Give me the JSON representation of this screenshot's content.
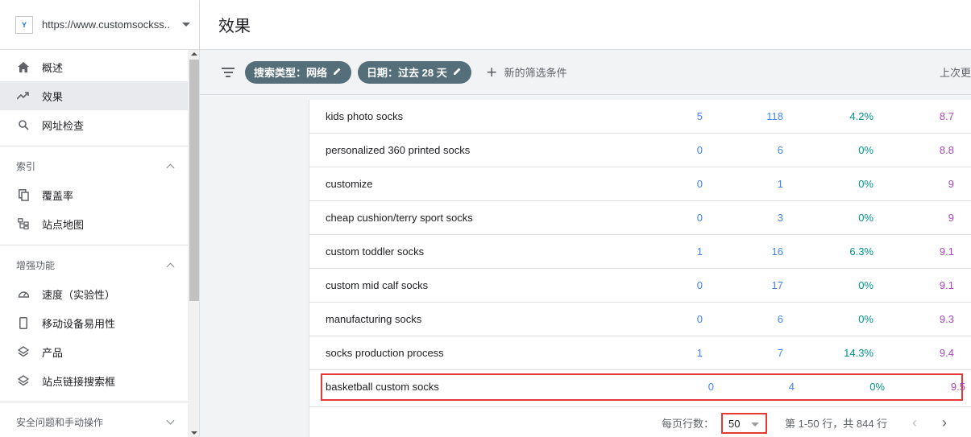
{
  "property": {
    "url": "https://www.customsockss....",
    "logo_text": "Y"
  },
  "header": {
    "title": "效果"
  },
  "sidebar": {
    "top_items": [
      {
        "label": "概述",
        "icon": "home-icon"
      },
      {
        "label": "效果",
        "icon": "trending-up-icon"
      },
      {
        "label": "网址检查",
        "icon": "search-icon"
      }
    ],
    "sections": [
      {
        "title": "索引",
        "items": [
          {
            "label": "覆盖率",
            "icon": "copy-icon"
          },
          {
            "label": "站点地图",
            "icon": "sitemap-icon"
          }
        ]
      },
      {
        "title": "增强功能",
        "items": [
          {
            "label": "速度（实验性）",
            "icon": "speed-icon"
          },
          {
            "label": "移动设备易用性",
            "icon": "phone-icon"
          },
          {
            "label": "产品",
            "icon": "layers-icon"
          },
          {
            "label": "站点链接搜索框",
            "icon": "layers-icon"
          }
        ]
      },
      {
        "title": "安全问题和手动操作",
        "items": []
      }
    ]
  },
  "filters": {
    "chips": [
      {
        "label": "搜索类型：网络"
      },
      {
        "label": "日期：过去 28 天"
      }
    ],
    "new_filter": "新的筛选条件",
    "last_update": "上次更"
  },
  "table": {
    "rows": [
      {
        "query": "kids photo socks",
        "clicks": "5",
        "impressions": "118",
        "ctr": "4.2%",
        "position": "8.7"
      },
      {
        "query": "personalized 360 printed socks",
        "clicks": "0",
        "impressions": "6",
        "ctr": "0%",
        "position": "8.8"
      },
      {
        "query": "customize",
        "clicks": "0",
        "impressions": "1",
        "ctr": "0%",
        "position": "9"
      },
      {
        "query": "cheap cushion/terry sport socks",
        "clicks": "0",
        "impressions": "3",
        "ctr": "0%",
        "position": "9"
      },
      {
        "query": "custom toddler socks",
        "clicks": "1",
        "impressions": "16",
        "ctr": "6.3%",
        "position": "9.1"
      },
      {
        "query": "custom mid calf socks",
        "clicks": "0",
        "impressions": "17",
        "ctr": "0%",
        "position": "9.1"
      },
      {
        "query": "manufacturing socks",
        "clicks": "0",
        "impressions": "6",
        "ctr": "0%",
        "position": "9.3"
      },
      {
        "query": "socks production process",
        "clicks": "1",
        "impressions": "7",
        "ctr": "14.3%",
        "position": "9.4"
      }
    ],
    "highlighted_row": {
      "query": "basketball custom socks",
      "clicks": "0",
      "impressions": "4",
      "ctr": "0%",
      "position": "9.5"
    }
  },
  "pagination": {
    "rows_per_page_label": "每页行数：",
    "rows_per_page": "50",
    "range_text": "第 1-50 行，共 844 行"
  },
  "colors": {
    "clicks": "#4285f4",
    "impressions": "#4285f4",
    "ctr": "#009688",
    "position": "#ab47bc",
    "highlight": "#e53935",
    "chip": "#546e7a"
  }
}
